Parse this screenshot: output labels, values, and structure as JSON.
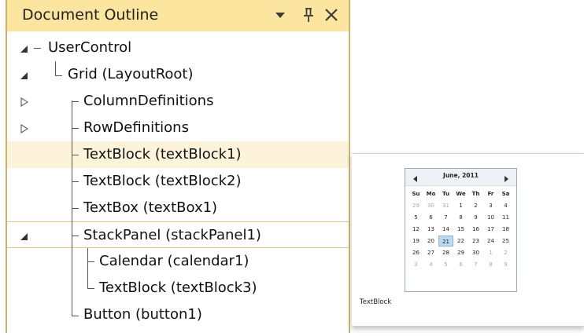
{
  "outline": {
    "title": "Document Outline",
    "nodes": [
      {
        "label": "UserControl",
        "expander": "expanded"
      },
      {
        "label": "Grid (LayoutRoot)",
        "expander": "expanded"
      },
      {
        "label": "ColumnDefinitions",
        "expander": "collapsed"
      },
      {
        "label": "RowDefinitions",
        "expander": "collapsed"
      },
      {
        "label": "TextBlock (textBlock1)",
        "expander": "none",
        "state": "hover"
      },
      {
        "label": "TextBlock (textBlock2)",
        "expander": "none"
      },
      {
        "label": "TextBox (textBox1)",
        "expander": "none"
      },
      {
        "label": "StackPanel (stackPanel1)",
        "expander": "expanded",
        "state": "selected"
      },
      {
        "label": "Calendar (calendar1)",
        "expander": "none"
      },
      {
        "label": "TextBlock (textBlock3)",
        "expander": "none"
      },
      {
        "label": "Button (button1)",
        "expander": "none"
      }
    ]
  },
  "design": {
    "calendar": {
      "title": "June, 2011",
      "days_of_week": [
        "Su",
        "Mo",
        "Tu",
        "We",
        "Th",
        "Fr",
        "Sa"
      ],
      "weeks": [
        [
          "29",
          "30",
          "31",
          "1",
          "2",
          "3",
          "4"
        ],
        [
          "5",
          "6",
          "7",
          "8",
          "9",
          "10",
          "11"
        ],
        [
          "12",
          "13",
          "14",
          "15",
          "16",
          "17",
          "18"
        ],
        [
          "19",
          "20",
          "21",
          "22",
          "23",
          "24",
          "25"
        ],
        [
          "26",
          "27",
          "28",
          "29",
          "30",
          "1",
          "2"
        ],
        [
          "3",
          "4",
          "5",
          "6",
          "7",
          "8",
          "9"
        ]
      ],
      "today": "21"
    },
    "textblock_label": "TextBlock"
  },
  "colors": {
    "header_bg": "#fce59f",
    "panel_border": "#cdb36a",
    "hover_row": "#fcf3da",
    "selected_row_border": "#e8c774",
    "calendar_today": "#bcd8ee"
  }
}
